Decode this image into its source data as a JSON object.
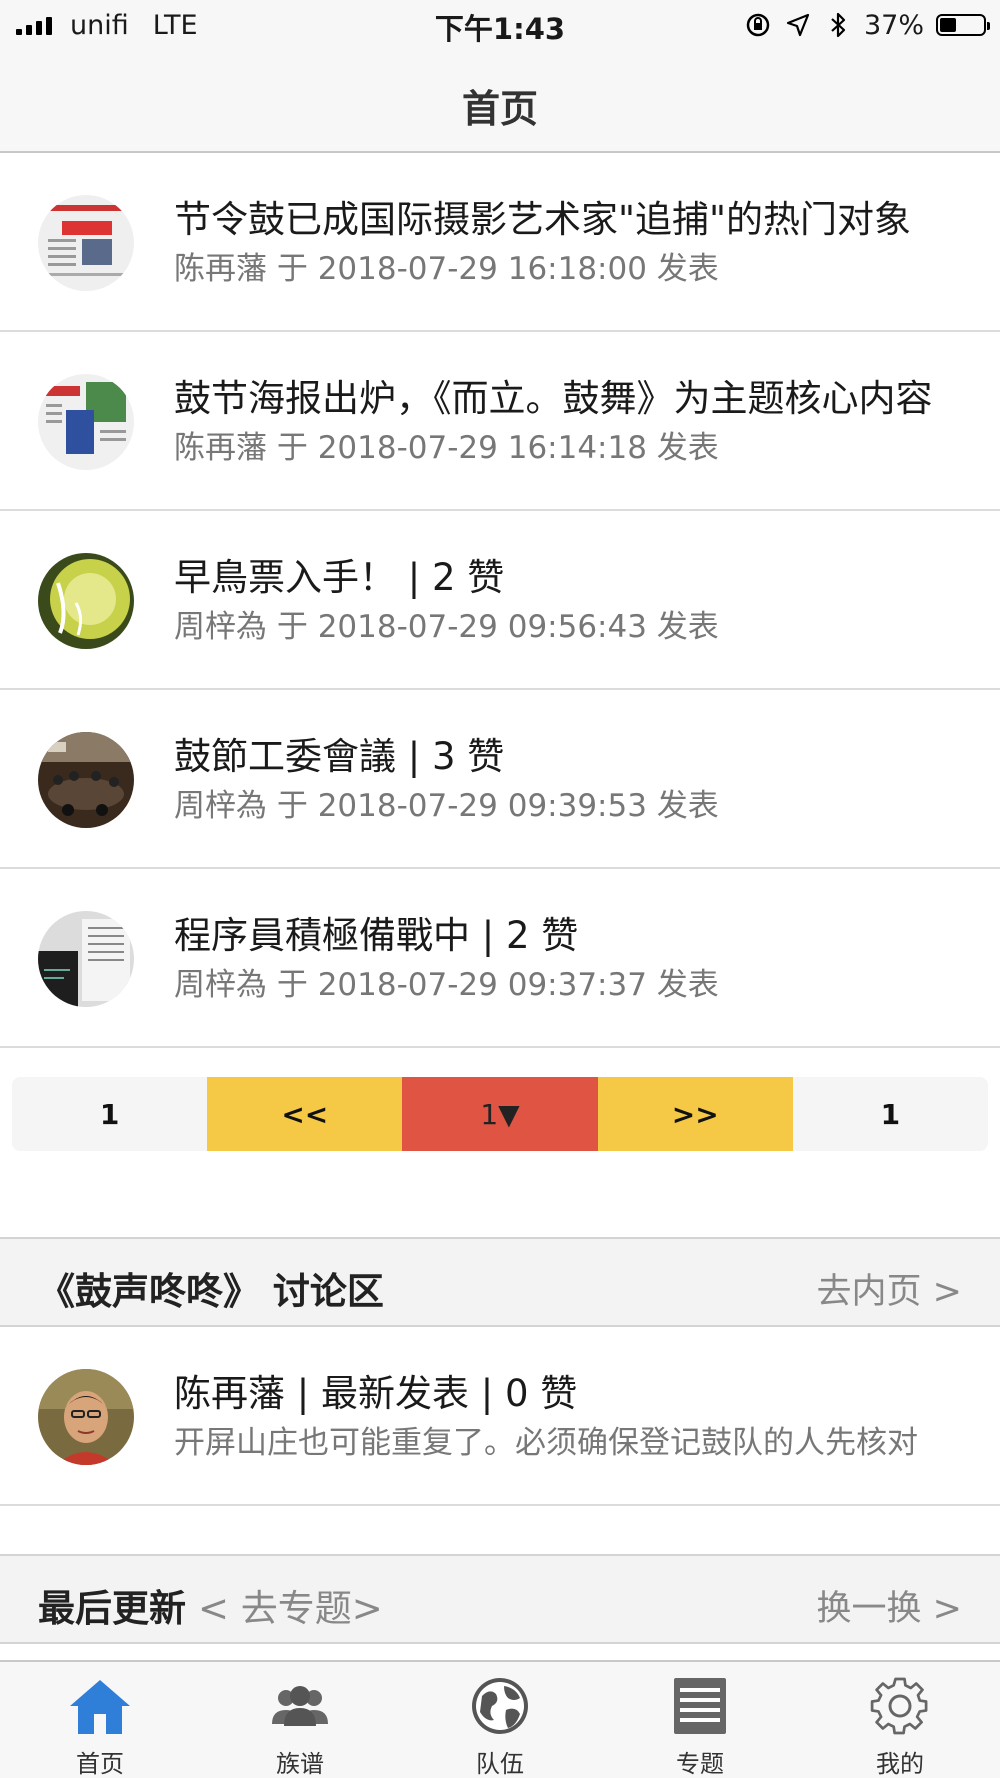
{
  "status_bar": {
    "carrier": "unifi",
    "network": "LTE",
    "time": "下午1:43",
    "battery_percent": "37%",
    "battery_level": 0.37
  },
  "nav": {
    "title": "首页"
  },
  "articles": [
    {
      "title": "节令鼓已成国际摄影艺术家\"追捕\"的热门对象",
      "meta": "陈再藩 于 2018-07-29 16:18:00 发表",
      "thumb": "newspaper-thumb"
    },
    {
      "title": "鼓节海报出炉，《而立。鼓舞》为主题核心内容",
      "meta": "陈再藩 于 2018-07-29 16:14:18 发表",
      "thumb": "poster-thumb"
    },
    {
      "title": "早鳥票入手！ | 2 赞",
      "meta": "周梓為 于 2018-07-29 09:56:43 发表",
      "thumb": "ticket-thumb"
    },
    {
      "title": "鼓節工委會議 | 3 赞",
      "meta": "周梓為 于 2018-07-29 09:39:53 发表",
      "thumb": "meeting-thumb"
    },
    {
      "title": "程序員積極備戰中 | 2 赞",
      "meta": "周梓為 于 2018-07-29 09:37:37 发表",
      "thumb": "screen-thumb"
    }
  ],
  "pager": {
    "first": "1",
    "prev": "<<",
    "current": "1▼",
    "next": ">>",
    "last": "1"
  },
  "discussion": {
    "title": "《鼓声咚咚》 讨论区",
    "link": "去内页 >",
    "post_title": "陈再藩 | 最新发表 | 0 赞",
    "post_excerpt": "开屏山庄也可能重复了。必须确保登记鼓队的人先核对"
  },
  "updates": {
    "title": "最后更新",
    "sub_link": "< 去专题>",
    "refresh": "换一换 >"
  },
  "tabs": [
    {
      "label": "首页",
      "icon": "home-icon",
      "active": true
    },
    {
      "label": "族谱",
      "icon": "people-icon",
      "active": false
    },
    {
      "label": "队伍",
      "icon": "globe-icon",
      "active": false
    },
    {
      "label": "专题",
      "icon": "document-icon",
      "active": false
    },
    {
      "label": "我的",
      "icon": "gear-icon",
      "active": false
    }
  ],
  "colors": {
    "accent": "#2f7fd9",
    "pager_yellow": "#f5c945",
    "pager_red": "#e05444"
  }
}
